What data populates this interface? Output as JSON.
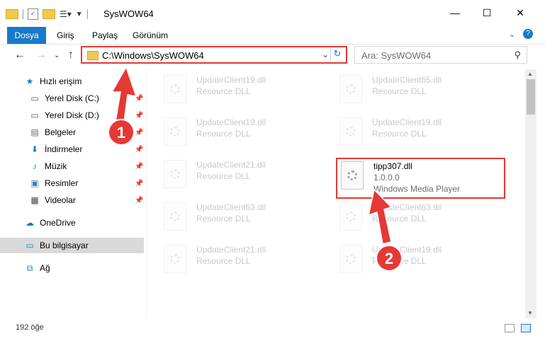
{
  "window": {
    "title": "SysWOW64",
    "minimize": "—",
    "maximize": "☐",
    "close": "✕"
  },
  "menu": {
    "file_tab": "Dosya",
    "items": [
      "Giriş",
      "Paylaş",
      "Görünüm"
    ]
  },
  "nav": {
    "address": "C:\\Windows\\SysWOW64",
    "search_placeholder": "Ara: SysWOW64"
  },
  "sidebar": {
    "items": [
      {
        "label": "Hızlı erişim",
        "icon": "star-icon"
      },
      {
        "label": "Yerel Disk (C:)",
        "icon": "drive-icon"
      },
      {
        "label": "Yerel Disk (D:)",
        "icon": "drive-icon"
      },
      {
        "label": "Belgeler",
        "icon": "documents-icon"
      },
      {
        "label": "İndirmeler",
        "icon": "download-icon"
      },
      {
        "label": "Müzik",
        "icon": "music-icon"
      },
      {
        "label": "Resimler",
        "icon": "pictures-icon"
      },
      {
        "label": "Videolar",
        "icon": "videos-icon"
      },
      {
        "label": "OneDrive",
        "icon": "cloud-icon"
      },
      {
        "label": "Bu bilgisayar",
        "icon": "computer-icon"
      },
      {
        "label": "Ağ",
        "icon": "network-icon"
      }
    ]
  },
  "files": [
    {
      "name": "UpdateClient19.dll",
      "sub": "Resource DLL"
    },
    {
      "name": "UpdateClient65.dll",
      "sub": "Resource DLL"
    },
    {
      "name": "UpdateClient19.dll",
      "sub": "Resource DLL"
    },
    {
      "name": "UpdateClient19.dll",
      "sub": "Resource DLL"
    },
    {
      "name": "UpdateClient21.dll",
      "sub": "Resource DLL"
    },
    {
      "name": "UpdateClient63.dll",
      "sub": "Resource DLL"
    },
    {
      "name": "UpdateClient63.dll",
      "sub": "Resource DLL"
    },
    {
      "name": "UpdateClient21.dll",
      "sub": "Resource DLL"
    },
    {
      "name": "UpdateClient19.dll",
      "sub": "Resource DLL"
    }
  ],
  "highlighted_file": {
    "name": "tipp307.dll",
    "version": "1.0.0.0",
    "product": "Windows Media Player"
  },
  "status": {
    "count": "192 öğe"
  },
  "annotations": {
    "step1": "1",
    "step2": "2",
    "color": "#e53935"
  }
}
